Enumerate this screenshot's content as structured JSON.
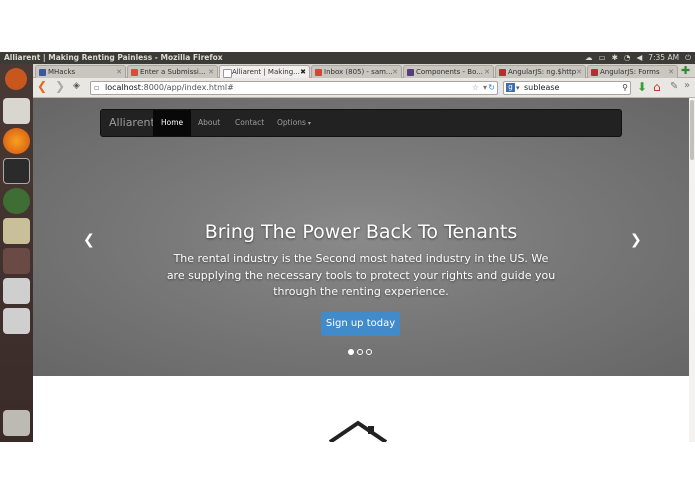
{
  "window": {
    "title": "Alliarent | Making Renting Painless - Mozilla Firefox",
    "clock": "7:35 AM"
  },
  "tabs": [
    {
      "label": "MHacks",
      "favicon_color": "#3b5998"
    },
    {
      "label": "Enter a Submissi...",
      "favicon_color": "#dd4b39"
    },
    {
      "label": "Alliarent | Making...",
      "favicon_color": "#ffffff",
      "active": true
    },
    {
      "label": "Inbox (805) - sam...",
      "favicon_color": "#d14836"
    },
    {
      "label": "Components - Bo...",
      "favicon_color": "#563d7c"
    },
    {
      "label": "AngularJS: ng.$http",
      "favicon_color": "#b52e31"
    },
    {
      "label": "AngularJS: Forms",
      "favicon_color": "#b52e31"
    }
  ],
  "address": {
    "host": "localhost",
    "path": ":8000/app/index.html#"
  },
  "search": {
    "value": "sublease"
  },
  "site": {
    "brand": "Alliarent",
    "nav": [
      "Home",
      "About",
      "Contact",
      "Options"
    ],
    "active_nav": "Home",
    "hero_title": "Bring The Power Back To Tenants",
    "hero_lead": "The rental industry is the Second most hated industry in the US. We are supplying the necessary tools to protect your rights and guide you through the renting experience.",
    "cta": "Sign up today",
    "slides": 3,
    "active_slide": 1
  },
  "colors": {
    "accent": "#428bca",
    "navbar": "#222222",
    "hero": "#777777"
  }
}
